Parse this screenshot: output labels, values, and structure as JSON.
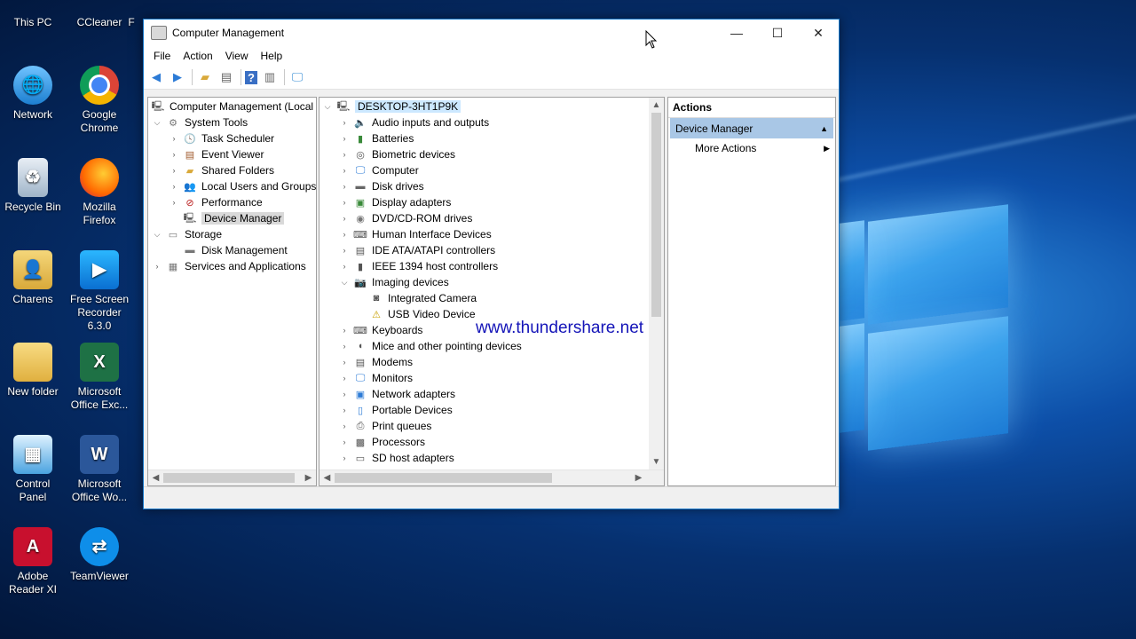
{
  "desktop": {
    "icons": [
      {
        "label": "This PC"
      },
      {
        "label": "CCleaner"
      },
      {
        "label": "F"
      },
      {
        "label": "Network"
      },
      {
        "label": "Google Chrome"
      },
      {
        "label": "Recycle Bin"
      },
      {
        "label": "Mozilla Firefox"
      },
      {
        "label": "Charens"
      },
      {
        "label": "Free Screen Recorder 6.3.0"
      },
      {
        "label": "New folder"
      },
      {
        "label": "Microsoft Office Exc..."
      },
      {
        "label": "Control Panel"
      },
      {
        "label": "Microsoft Office Wo..."
      },
      {
        "label": "Adobe Reader XI"
      },
      {
        "label": "TeamViewer"
      }
    ]
  },
  "window": {
    "title": "Computer Management",
    "minimize": "—",
    "maximize": "☐",
    "close": "✕"
  },
  "menu": [
    "File",
    "Action",
    "View",
    "Help"
  ],
  "left_tree": {
    "root": "Computer Management (Local",
    "system_tools": "System Tools",
    "task_scheduler": "Task Scheduler",
    "event_viewer": "Event Viewer",
    "shared_folders": "Shared Folders",
    "local_users": "Local Users and Groups",
    "performance": "Performance",
    "device_manager": "Device Manager",
    "storage": "Storage",
    "disk_management": "Disk Management",
    "services": "Services and Applications"
  },
  "device_tree": {
    "root": "DESKTOP-3HT1P9K",
    "items": [
      "Audio inputs and outputs",
      "Batteries",
      "Biometric devices",
      "Computer",
      "Disk drives",
      "Display adapters",
      "DVD/CD-ROM drives",
      "Human Interface Devices",
      "IDE ATA/ATAPI controllers",
      "IEEE 1394 host controllers",
      "Imaging devices",
      "Integrated Camera",
      "USB Video Device",
      "Keyboards",
      "Mice and other pointing devices",
      "Modems",
      "Monitors",
      "Network adapters",
      "Portable Devices",
      "Print queues",
      "Processors",
      "SD host adapters"
    ]
  },
  "actions": {
    "header": "Actions",
    "section": "Device Manager",
    "more": "More Actions"
  },
  "watermark": "www.thundershare.net",
  "colors": {
    "window_border": "#1979ca",
    "selection_blue": "#cce8ff",
    "actions_band": "#a9c7e6",
    "watermark": "#1515b8"
  }
}
